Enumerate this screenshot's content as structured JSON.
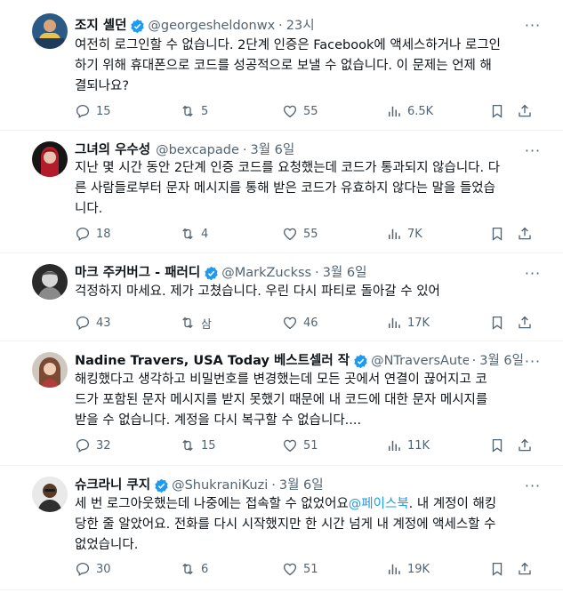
{
  "tweets": [
    {
      "name": "조지 셸던",
      "handle": "@georgesheldonwx",
      "time": "23시",
      "text": "여전히 로그인할 수 없습니다. 2단계 인증은 Facebook에 액세스하거나 로그인\n하기 위해 휴대폰으로 코드를 성공적으로 보낼 수 없습니다. 이 문제는 언제 해\n결되나요?",
      "mention": "",
      "replies": "15",
      "retweets": "5",
      "likes": "55",
      "views": "6.5K",
      "verified": true
    },
    {
      "name": "그녀의 우수성",
      "handle": "@bexcapade",
      "time": "3월 6일",
      "text": "지난 몇 시간 동안 2단계 인증 코드를 요청했는데 코드가 통과되지 않습니다. 다\n른 사람들로부터 문자 메시지를 통해 받은 코드가 유효하지 않다는 말을 들었습\n니다.",
      "mention": "",
      "replies": "18",
      "retweets": "4",
      "likes": "55",
      "views": "7K",
      "verified": false
    },
    {
      "name": "마크 주커버그 - 패러디",
      "handle": "@MarkZuckss",
      "time": "3월 6일",
      "text": "걱정하지 마세요. 제가 고쳤습니다. 우린 다시 파티로 돌아갈 수 있어",
      "mention": "",
      "replies": "43",
      "retweets": "삼",
      "likes": "46",
      "views": "17K",
      "verified": true
    },
    {
      "name": "Nadine Travers, USA Today 베스트셀러 작",
      "handle": "@NTraversAuteur",
      "time": "3월 6일",
      "text": "해킹했다고 생각하고 비밀번호를 변경했는데 모든 곳에서 연결이 끊어지고 코\n드가 포함된 문자 메시지를 받지 못했기 때문에 내 코드에 대한 문자 메시지를\n받을 수 없습니다. 계정을 다시 복구할 수 없습니다....",
      "mention": "",
      "replies": "32",
      "retweets": "15",
      "likes": "51",
      "views": "11K",
      "verified": true
    },
    {
      "name": "슈크라니 쿠지",
      "handle": "@ShukraniKuzi",
      "time": "3월 6일",
      "text_before": "세 번 로그아웃했는데 나중에는 접속할 수 없었어요",
      "mention": "@페이스북",
      "text_after": ". 내 계정이 해킹\n당한 줄 알았어요. 전화를 다시 시작했지만 한 시간 넘게 내 계정에 액세스할 수\n없었습니다.",
      "replies": "30",
      "retweets": "6",
      "likes": "51",
      "views": "19K",
      "verified": true
    }
  ],
  "colors": {
    "accent": "#1d9bf0",
    "muted": "#536471",
    "text": "#0f1419",
    "divider": "#eff3f4"
  },
  "icons": {
    "reply": "reply-icon",
    "retweet": "retweet-icon",
    "like": "heart-icon",
    "views": "views-icon",
    "bookmark": "bookmark-icon",
    "share": "share-icon",
    "verified": "verified-badge-icon",
    "more": "more-icon"
  }
}
